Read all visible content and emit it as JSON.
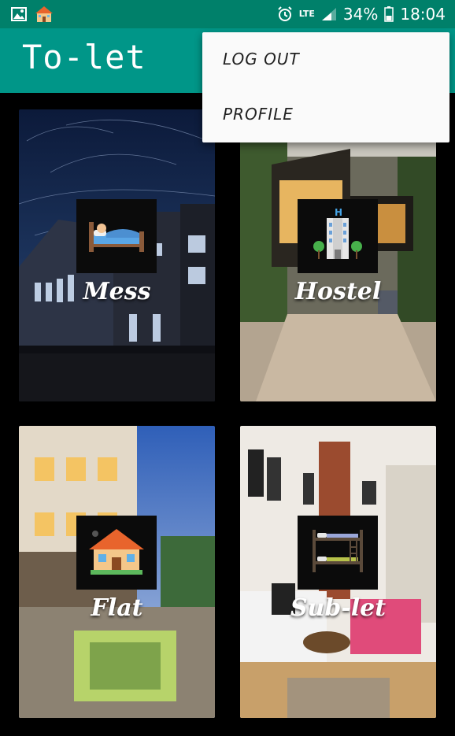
{
  "status_bar": {
    "left_icons": [
      "image-icon",
      "house-notification-icon"
    ],
    "right_icons": [
      "alarm-icon",
      "lte-icon",
      "signal-icon",
      "battery-icon"
    ],
    "lte": "LTE",
    "battery_percent": "34%",
    "time": "18:04"
  },
  "app_bar": {
    "title": "To-let"
  },
  "overflow_menu": {
    "items": [
      {
        "label": "LOG OUT"
      },
      {
        "label": "PROFILE"
      }
    ]
  },
  "categories": [
    {
      "label": "Mess",
      "icon": "bed-icon"
    },
    {
      "label": "Hostel",
      "icon": "hotel-building-icon"
    },
    {
      "label": "Flat",
      "icon": "house-icon"
    },
    {
      "label": "Sub-let",
      "icon": "bunk-bed-icon"
    }
  ],
  "colors": {
    "status_bar": "#00806a",
    "app_bar": "#009688",
    "menu_background": "#fafafa",
    "screen_background": "#000000"
  }
}
